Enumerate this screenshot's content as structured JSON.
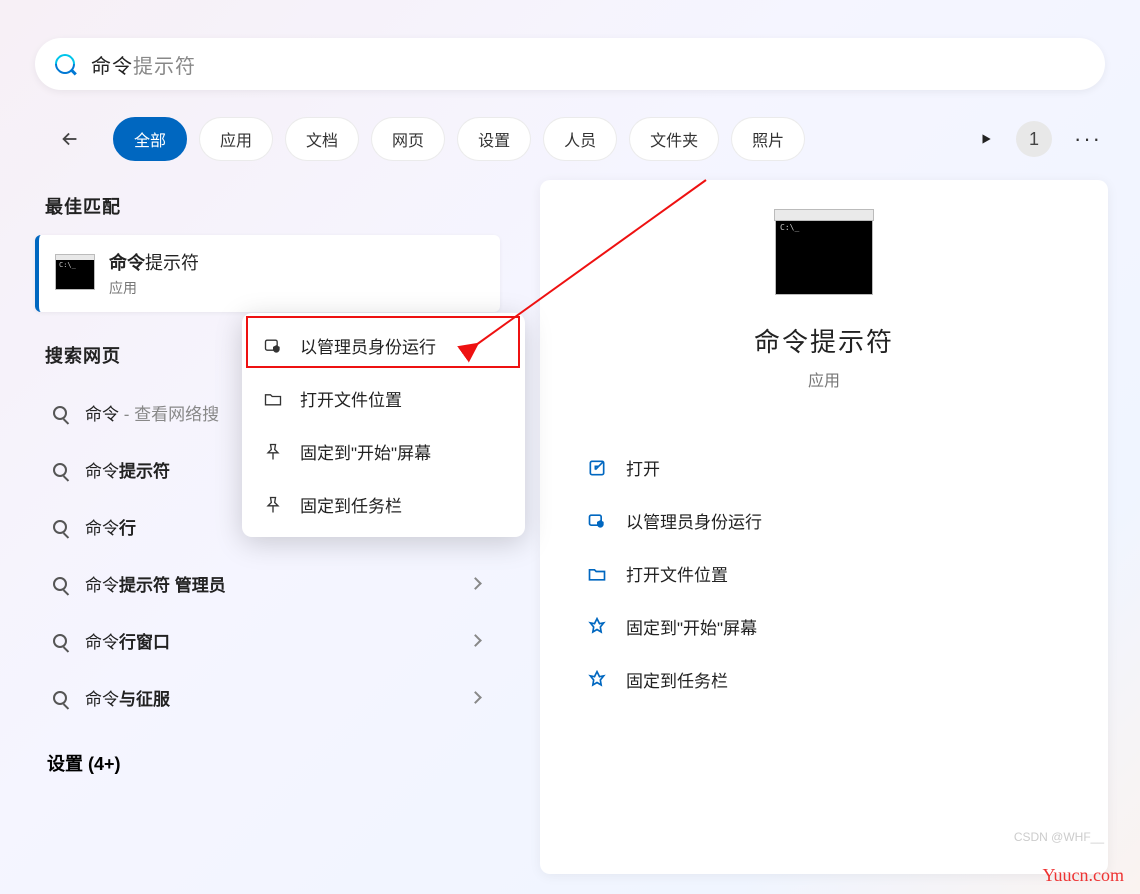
{
  "search": {
    "typed": "命令",
    "completion": "提示符"
  },
  "filters": {
    "all": "全部",
    "apps": "应用",
    "docs": "文档",
    "web": "网页",
    "settings": "设置",
    "people": "人员",
    "folders": "文件夹",
    "photos": "照片"
  },
  "counter": "1",
  "left": {
    "best_match_title": "最佳匹配",
    "result_bold": "命令",
    "result_thin": "提示符",
    "result_sub": "应用",
    "web_title": "搜索网页",
    "web_items": [
      {
        "pre": "命令",
        "bold": "",
        "hint": " - 查看网络搜"
      },
      {
        "pre": "命令",
        "bold": "提示符",
        "hint": ""
      },
      {
        "pre": "命令",
        "bold": "行",
        "hint": ""
      },
      {
        "pre": "命令",
        "bold": "提示符 管理员",
        "hint": ""
      },
      {
        "pre": "命令",
        "bold": "行窗口",
        "hint": ""
      },
      {
        "pre": "命令",
        "bold": "与征服",
        "hint": ""
      }
    ],
    "settings_row": "设置 (4+)"
  },
  "context_menu": [
    "以管理员身份运行",
    "打开文件位置",
    "固定到\"开始\"屏幕",
    "固定到任务栏"
  ],
  "right": {
    "title": "命令提示符",
    "sub": "应用",
    "actions": [
      "打开",
      "以管理员身份运行",
      "打开文件位置",
      "固定到\"开始\"屏幕",
      "固定到任务栏"
    ]
  },
  "watermark": "Yuucn.com",
  "watermark2": "CSDN @WHF__"
}
